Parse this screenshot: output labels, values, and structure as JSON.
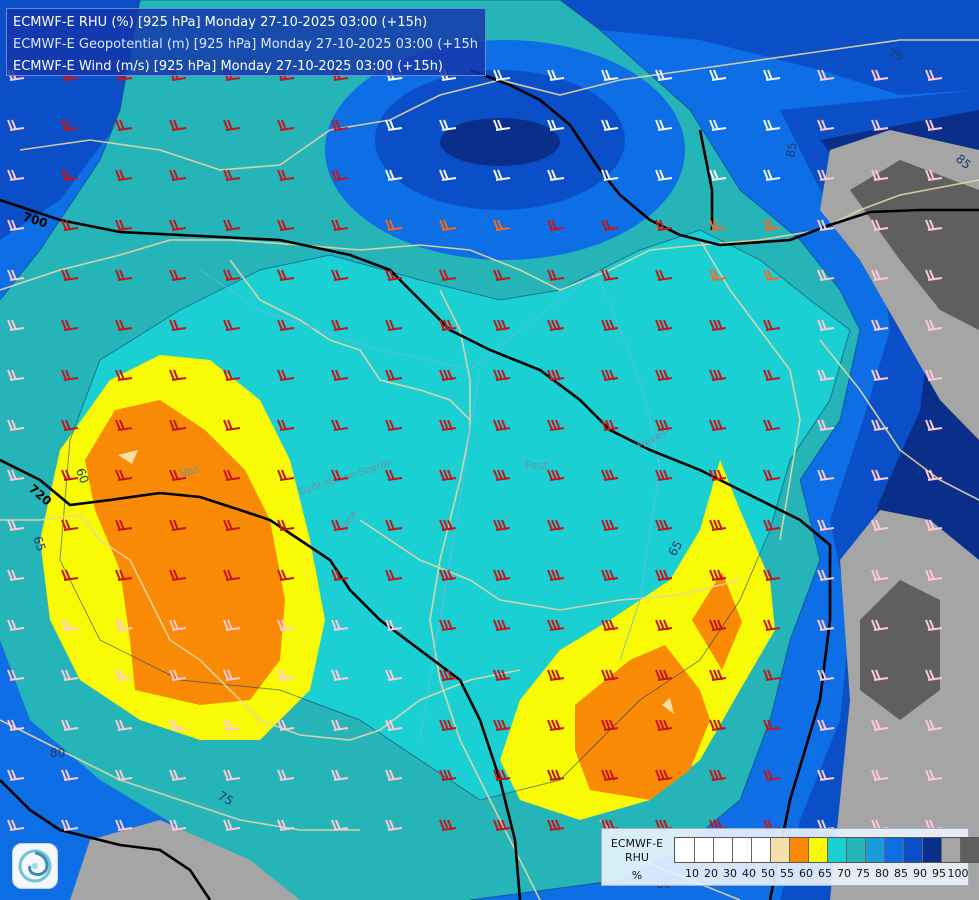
{
  "header": {
    "line1": "ECMWF-E RHU (%) [925 hPa] Monday 27-10-2025 03:00 (+15h)",
    "line2": "ECMWF-E Geopotential (m) [925 hPa] Monday 27-10-2025 03:00 (+15h)",
    "line3": "ECMWF-E Wind (m/s) [925 hPa] Monday 27-10-2025 03:00 (+15h)"
  },
  "legend": {
    "title_line1": "ECMWF-E",
    "title_line2": "RHU",
    "unit": "%",
    "colors": [
      "#ffffff",
      "#ffffff",
      "#ffffff",
      "#ffffff",
      "#ffffff",
      "#f8dfaa",
      "#f98a05",
      "#f8fb05",
      "#1ad0d2",
      "#25b4b8",
      "#1a9cda",
      "#0d6ee6",
      "#0a4fc8",
      "#0a2f8a",
      "#a5a5a5",
      "#5f5f5f"
    ],
    "ticks": [
      "10",
      "20",
      "30",
      "40",
      "50",
      "55",
      "60",
      "65",
      "70",
      "75",
      "80",
      "85",
      "90",
      "95",
      "100"
    ]
  },
  "map_labels": {
    "contour_700": "700",
    "contour_720": "720",
    "rh_60": "60",
    "rh_65a": "65",
    "rh_65b": "65",
    "rh_75": "75",
    "rh_80": "80",
    "rh_85": "85",
    "rh_85b": "85",
    "rh_75b": "75",
    "rh_80b": "80",
    "place_vas": "Vas",
    "place_tolna": "Tolna",
    "place_pest": "Pest",
    "place_heves": "Heves",
    "place_gyor": "Győr-Moson-Sopron"
  },
  "colors": {
    "c95": "#5f5f5f",
    "c90": "#a5a5a5",
    "c85": "#0a2f8a",
    "c80": "#0a4fc8",
    "c75": "#0d6ee6",
    "c70": "#1a9cda",
    "c65": "#25b4b8",
    "c60": "#1ad0d2",
    "c55": "#f8fb05",
    "c50": "#f98a05",
    "c45": "#f8dfaa"
  }
}
